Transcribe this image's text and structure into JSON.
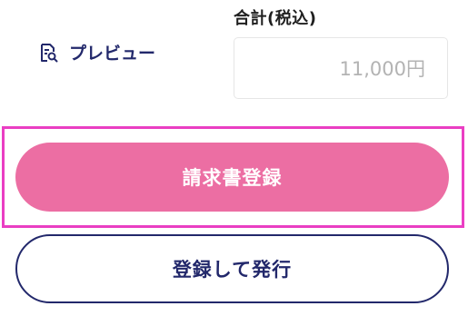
{
  "summary": {
    "total_label": "合計(税込)",
    "total_value": "11,000円"
  },
  "preview": {
    "label": "プレビュー",
    "icon": "document-search-icon"
  },
  "actions": {
    "register_label": "請求書登録",
    "register_and_issue_label": "登録して発行"
  },
  "colors": {
    "primary_pink": "#ec6ea3",
    "navy": "#22286b",
    "highlight_magenta": "#ea3ec3"
  }
}
